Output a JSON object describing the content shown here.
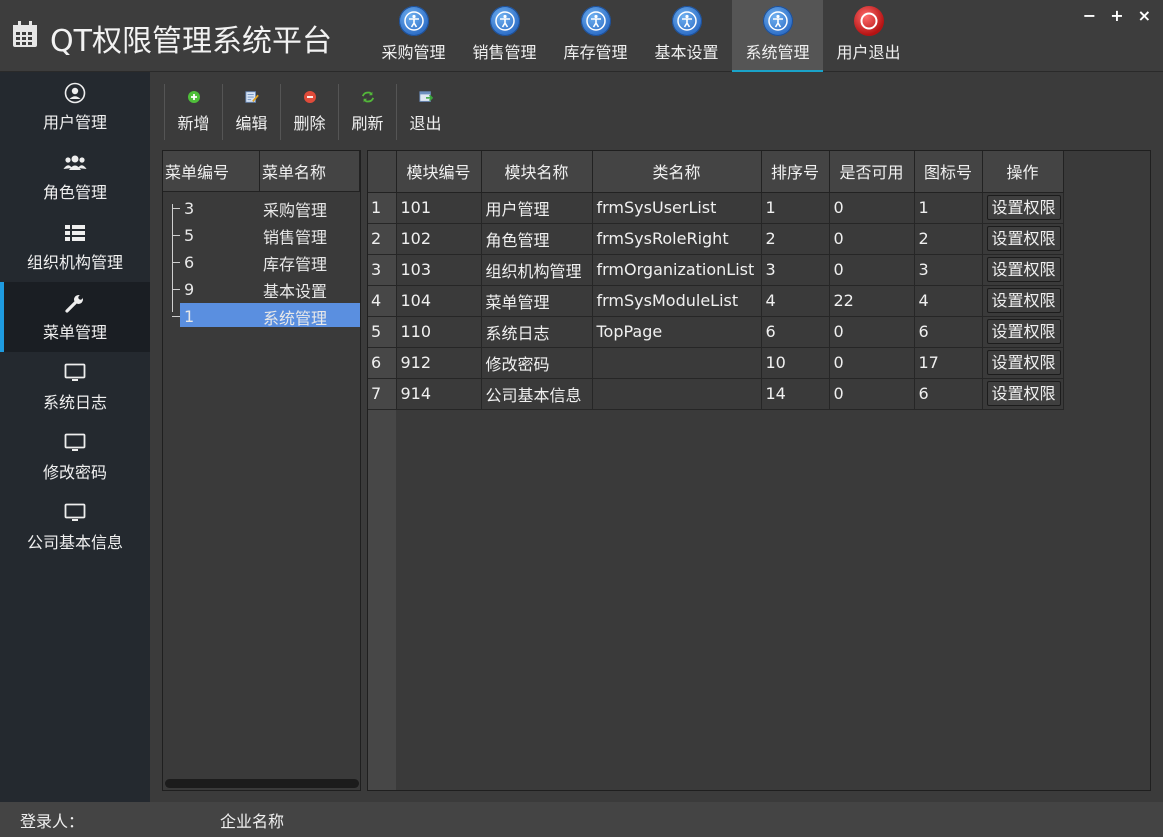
{
  "app": {
    "title": "QT权限管理系统平台",
    "icon": "calendar-icon"
  },
  "topnav": {
    "items": [
      {
        "label": "采购管理",
        "icon": "accessibility-person-icon"
      },
      {
        "label": "销售管理",
        "icon": "accessibility-person-icon"
      },
      {
        "label": "库存管理",
        "icon": "accessibility-person-icon"
      },
      {
        "label": "基本设置",
        "icon": "accessibility-person-icon"
      },
      {
        "label": "系统管理",
        "icon": "accessibility-person-icon",
        "active": true
      },
      {
        "label": "用户退出",
        "icon": "exit-circle-icon"
      }
    ],
    "active_color": "#1aa3c9"
  },
  "window_controls": {
    "minimize": "−",
    "maximize": "+",
    "close": "×"
  },
  "sidebar": {
    "items": [
      {
        "label": "用户管理",
        "icon": "user-circle-icon"
      },
      {
        "label": "角色管理",
        "icon": "users-group-icon"
      },
      {
        "label": "组织机构管理",
        "icon": "list-icon"
      },
      {
        "label": "菜单管理",
        "icon": "wrench-icon",
        "active": true
      },
      {
        "label": "系统日志",
        "icon": "monitor-icon"
      },
      {
        "label": "修改密码",
        "icon": "monitor-icon"
      },
      {
        "label": "公司基本信息",
        "icon": "monitor-icon"
      }
    ],
    "active_color": "#1e9be0"
  },
  "toolbar": {
    "add_label": "新增",
    "edit_label": "编辑",
    "delete_label": "删除",
    "refresh_label": "刷新",
    "exit_label": "退出"
  },
  "tree": {
    "headers": [
      "菜单编号",
      "菜单名称"
    ],
    "rows": [
      {
        "id": "3",
        "name": "采购管理"
      },
      {
        "id": "5",
        "name": "销售管理"
      },
      {
        "id": "6",
        "name": "库存管理"
      },
      {
        "id": "9",
        "name": "基本设置"
      },
      {
        "id": "1",
        "name": "系统管理",
        "selected": true
      }
    ],
    "selected_color": "#5a8fe0"
  },
  "grid": {
    "headers": [
      "模块编号",
      "模块名称",
      "类名称",
      "排序号",
      "是否可用",
      "图标号",
      "操作"
    ],
    "rows": [
      {
        "n": "1",
        "code": "101",
        "name": "用户管理",
        "cls": "frmSysUserList",
        "order": "1",
        "enabled": "0",
        "icon": "1",
        "action": "设置权限"
      },
      {
        "n": "2",
        "code": "102",
        "name": "角色管理",
        "cls": "frmSysRoleRight",
        "order": "2",
        "enabled": "0",
        "icon": "2",
        "action": "设置权限"
      },
      {
        "n": "3",
        "code": "103",
        "name": "组织机构管理",
        "cls": "frmOrganizationList",
        "order": "3",
        "enabled": "0",
        "icon": "3",
        "action": "设置权限"
      },
      {
        "n": "4",
        "code": "104",
        "name": "菜单管理",
        "cls": "frmSysModuleList",
        "order": "4",
        "enabled": "22",
        "icon": "4",
        "action": "设置权限"
      },
      {
        "n": "5",
        "code": "110",
        "name": "系统日志",
        "cls": "TopPage",
        "order": "6",
        "enabled": "0",
        "icon": "6",
        "action": "设置权限"
      },
      {
        "n": "6",
        "code": "912",
        "name": "修改密码",
        "cls": "",
        "order": "10",
        "enabled": "0",
        "icon": "17",
        "action": "设置权限"
      },
      {
        "n": "7",
        "code": "914",
        "name": "公司基本信息",
        "cls": "",
        "order": "14",
        "enabled": "0",
        "icon": "6",
        "action": "设置权限"
      }
    ]
  },
  "status": {
    "login_label": "登录人：",
    "company_label": "企业名称"
  }
}
